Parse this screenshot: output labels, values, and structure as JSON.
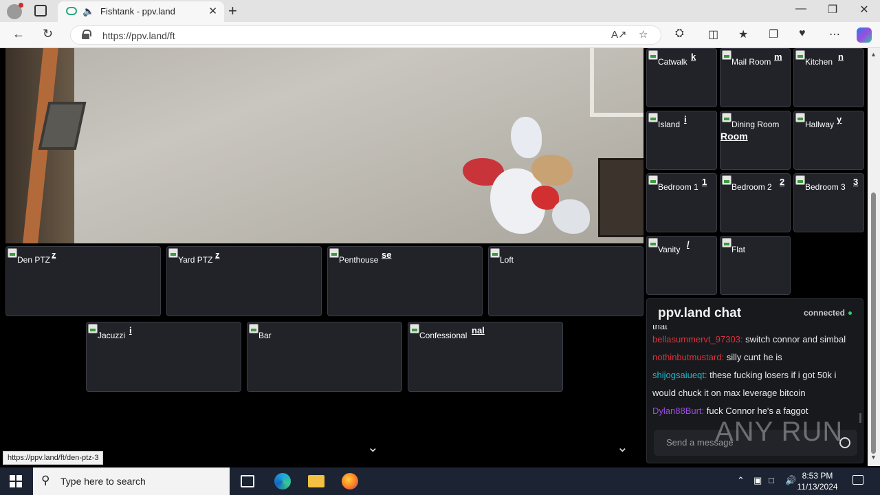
{
  "browser": {
    "tab_title": "Fishtank - ppv.land",
    "url": "https://ppv.land/ft",
    "status_url": "https://ppv.land/ft/den-ptz-3"
  },
  "cameras_grid": [
    {
      "label": "Den PTZ",
      "hot": "z"
    },
    {
      "label": "Yard PTZ",
      "hot": "z"
    },
    {
      "label": "Penthouse",
      "hot": "se"
    },
    {
      "label": "Loft",
      "hot": ""
    },
    {
      "label": "Jacuzzi",
      "hot": "i"
    },
    {
      "label": "Bar",
      "hot": ""
    },
    {
      "label": "Confessional",
      "hot": "nal"
    }
  ],
  "cameras_side": [
    {
      "label": "Catwalk",
      "hot": "k"
    },
    {
      "label": "Mail Room",
      "hot": "m"
    },
    {
      "label": "Kitchen",
      "hot": "n"
    },
    {
      "label": "Island",
      "hot": "i"
    },
    {
      "label": "Dining Room",
      "hot": "Room"
    },
    {
      "label": "Hallway",
      "hot": "y"
    },
    {
      "label": "Bedroom 1",
      "hot": "1"
    },
    {
      "label": "Bedroom 2",
      "hot": "2"
    },
    {
      "label": "Bedroom 3",
      "hot": "3"
    },
    {
      "label": "Vanity",
      "hot": "/"
    },
    {
      "label": "Flat",
      "hot": ""
    }
  ],
  "chat": {
    "title": "ppv.land chat",
    "status": "connected",
    "partial_line": "that",
    "messages": [
      {
        "user": "bellasummervt_97303:",
        "text": " switch connor and simbal",
        "color": "#e0303a"
      },
      {
        "user": "nothinbutmustard:",
        "text": " silly cunt he is",
        "color": "#e0303a"
      },
      {
        "user": "shijogsaiueqt:",
        "text": " these fucking losers if i got 50k i would chuck it on max leverage bitcoin",
        "color": "#22b8c8"
      },
      {
        "user": "Dylan88Burt:",
        "text": " fuck Connor he's a faggot",
        "color": "#9b4de0"
      }
    ],
    "input_placeholder": "Send a message"
  },
  "watermark": "ANY RUN",
  "taskbar": {
    "search_placeholder": "Type here to search",
    "time": "8:53 PM",
    "date": "11/13/2024"
  }
}
